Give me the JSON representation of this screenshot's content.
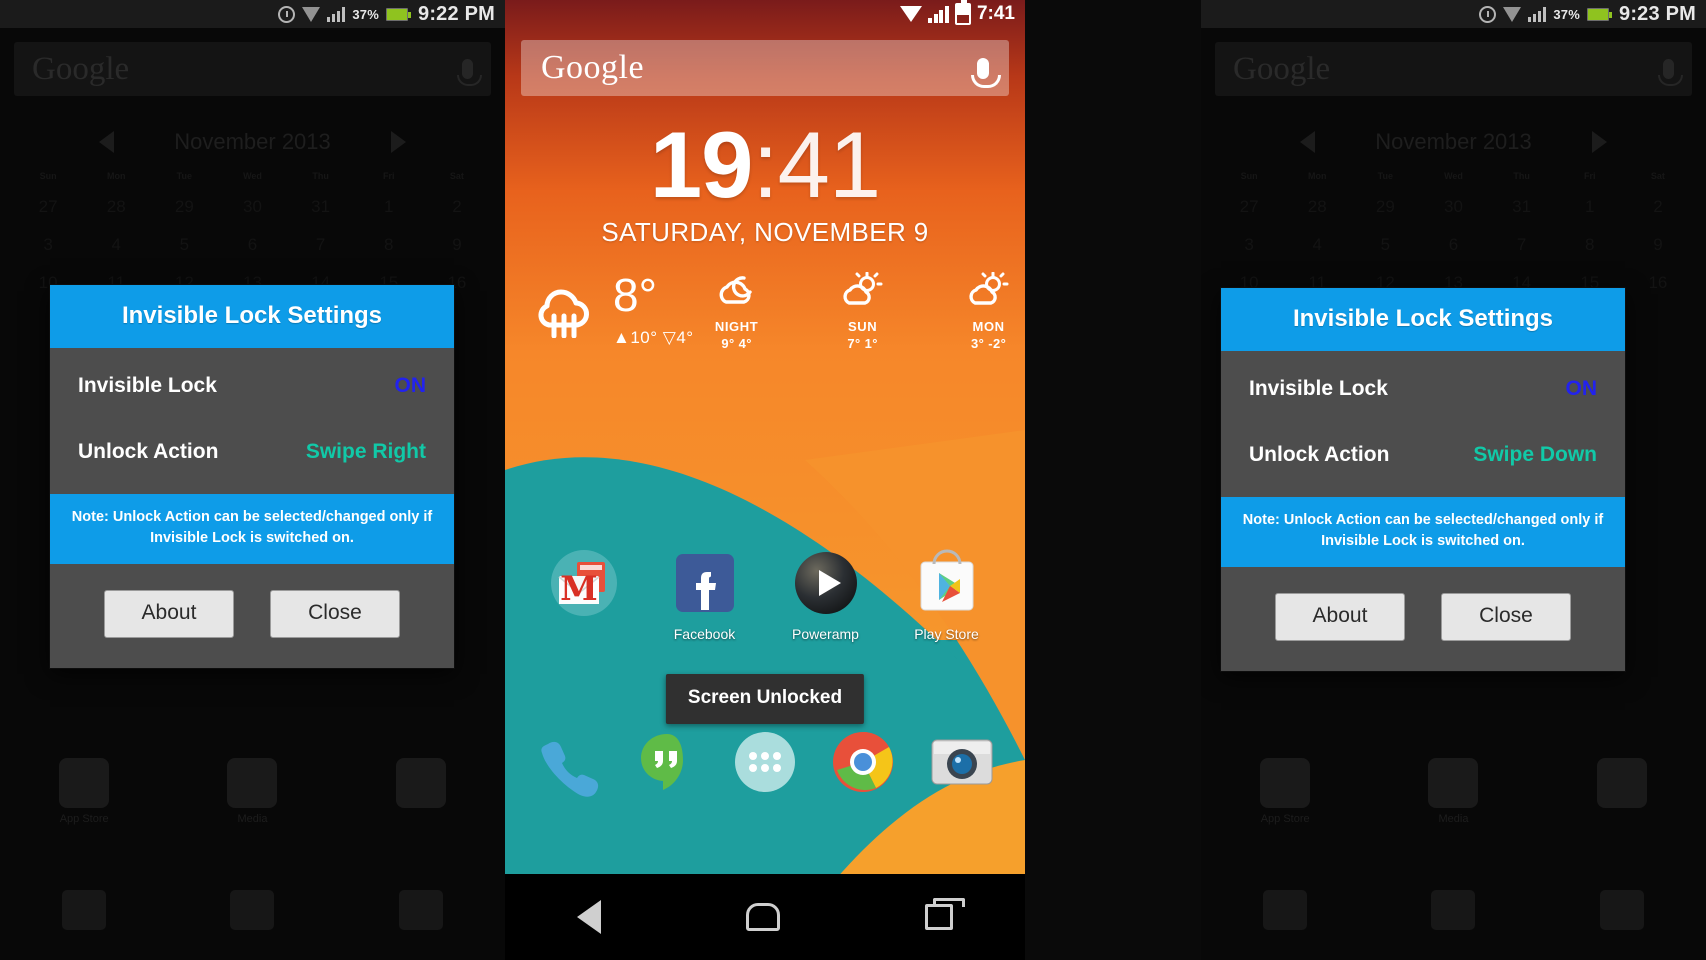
{
  "panels": {
    "left": {
      "statusbar": {
        "battery_pct": "37%",
        "clock": "9:22 PM",
        "icons": [
          "alarm-icon",
          "wifi-icon",
          "signal-bars-icon",
          "battery-icon"
        ]
      },
      "background": {
        "search_text": "Google",
        "calendar_month": "November 2013",
        "weekdays": [
          "Sun",
          "Mon",
          "Tue",
          "Wed",
          "Thu",
          "Fri",
          "Sat"
        ],
        "weeks": [
          [
            "27",
            "28",
            "29",
            "30",
            "31",
            "1",
            "2"
          ],
          [
            "3",
            "4",
            "5",
            "6",
            "7",
            "8",
            "9"
          ],
          [
            "10",
            "11",
            "12",
            "13",
            "14",
            "15",
            "16"
          ]
        ],
        "dock_labels": [
          "App Store",
          "Media"
        ]
      },
      "dialog": {
        "title": "Invisible Lock Settings",
        "rows": [
          {
            "label": "Invisible Lock",
            "value": "ON",
            "value_kind": "on"
          },
          {
            "label": "Unlock Action",
            "value": "Swipe Right",
            "value_kind": "action"
          }
        ],
        "note": "Note: Unlock Action can be selected/changed only if Invisible Lock is switched on.",
        "buttons": [
          "About",
          "Close"
        ]
      }
    },
    "right": {
      "statusbar": {
        "battery_pct": "37%",
        "clock": "9:23 PM",
        "icons": [
          "alarm-icon",
          "wifi-icon",
          "signal-bars-icon",
          "battery-icon"
        ]
      },
      "background": {
        "search_text": "Google",
        "calendar_month": "November 2013",
        "weekdays": [
          "Sun",
          "Mon",
          "Tue",
          "Wed",
          "Thu",
          "Fri",
          "Sat"
        ],
        "weeks": [
          [
            "27",
            "28",
            "29",
            "30",
            "31",
            "1",
            "2"
          ],
          [
            "3",
            "4",
            "5",
            "6",
            "7",
            "8",
            "9"
          ],
          [
            "10",
            "11",
            "12",
            "13",
            "14",
            "15",
            "16"
          ]
        ],
        "dock_labels": [
          "App Store",
          "Media"
        ]
      },
      "dialog": {
        "title": "Invisible Lock Settings",
        "rows": [
          {
            "label": "Invisible Lock",
            "value": "ON",
            "value_kind": "on"
          },
          {
            "label": "Unlock Action",
            "value": "Swipe Down",
            "value_kind": "action"
          }
        ],
        "note": "Note: Unlock Action can be selected/changed only if Invisible Lock is switched on.",
        "buttons": [
          "About",
          "Close"
        ]
      }
    },
    "center": {
      "statusbar": {
        "clock": "7:41",
        "icons": [
          "sim-card-icon",
          "wifi-icon",
          "signal-bars-icon",
          "battery-icon"
        ]
      },
      "search": {
        "logo_text": "Google",
        "mic_icon": "microphone-icon"
      },
      "clock_widget": {
        "hours": "19",
        "separator": ":",
        "minutes": "41",
        "date": "SATURDAY, NOVEMBER 9"
      },
      "weather": {
        "current_icon": "rain-cloud-icon",
        "current_temp": "8°",
        "high_low": "▲10° ▽4°",
        "forecast": [
          {
            "icon": "cloudy-night-icon",
            "label": "NIGHT",
            "temps": "9° 4°"
          },
          {
            "icon": "partly-sunny-icon",
            "label": "SUN",
            "temps": "7° 1°"
          },
          {
            "icon": "partly-sunny-icon",
            "label": "MON",
            "temps": "3° -2°"
          }
        ]
      },
      "apps": [
        {
          "icon": "gmail-icon",
          "label": ""
        },
        {
          "icon": "facebook-icon",
          "label": "Facebook"
        },
        {
          "icon": "poweramp-icon",
          "label": "Poweramp"
        },
        {
          "icon": "play-store-icon",
          "label": "Play Store"
        }
      ],
      "toast": "Screen Unlocked",
      "dock": [
        {
          "icon": "phone-icon"
        },
        {
          "icon": "hangouts-icon"
        },
        {
          "icon": "app-drawer-icon"
        },
        {
          "icon": "chrome-icon"
        },
        {
          "icon": "camera-icon"
        }
      ],
      "navbar": [
        {
          "icon": "back-icon"
        },
        {
          "icon": "home-icon"
        },
        {
          "icon": "recents-icon"
        }
      ]
    }
  },
  "colors": {
    "dialog_accent": "#0e9ce8",
    "dialog_body": "#4d4d4d",
    "value_on": "#2222ee",
    "value_action": "#11c9a8",
    "home_orange": "#f6922c",
    "home_teal": "#1e9e9e"
  }
}
